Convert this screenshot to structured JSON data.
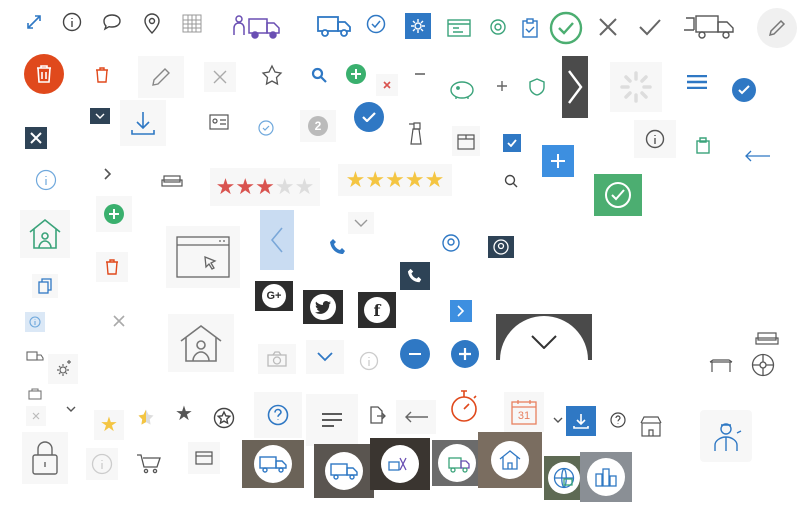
{
  "colors": {
    "accent_blue": "#2f78c4",
    "dark_navy": "#2e4356",
    "brand_orange": "#e0491c",
    "check_green": "#4cae71",
    "star_red": "#d9534f",
    "star_gold": "#f4c542",
    "light_blue_tile": "#c9dcf2",
    "bg_tile": "#f7f7f7"
  },
  "icons": [
    "expand-icon",
    "info-icon",
    "chat-icon",
    "location-pin-icon",
    "calendar-grid-icon",
    "delivery-truck-people-icon",
    "truck-icon",
    "check-circle-icon",
    "settings-badge-icon",
    "store-id-card-icon",
    "gear-shield-icon",
    "clipboard-icon",
    "green-check-circle-icon",
    "close-icon",
    "checkmark-icon",
    "truck-boxes-icon",
    "pencil-icon",
    "trash-round-icon",
    "trash-icon",
    "edit-pencil-icon",
    "close-light-icon",
    "star-add-icon",
    "search-icon",
    "plus-green-icon",
    "close-red-icon",
    "minus-icon",
    "piggy-bank-icon",
    "plus-icon",
    "shield-icon",
    "chevron-right-dark-icon",
    "spinner-icon",
    "hamburger-icon",
    "check-blue-circle-icon",
    "chevron-down-dark-icon",
    "download-icon",
    "id-card-icon",
    "check-outline-icon",
    "badge-number-icon",
    "check-circle-blue-icon",
    "spray-bottle-icon",
    "package-icon",
    "checkbox-checked-icon",
    "plus-blue-square-icon",
    "info-outline-icon",
    "clipboard-green-icon",
    "arrow-left-icon",
    "close-dark-icon",
    "info-circle-icon",
    "chevron-right-icon",
    "sofa-icon",
    "star-rating-red",
    "star-rating-gold",
    "search-small-icon",
    "check-green-square-icon",
    "home-user-icon",
    "plus-green-circle-icon",
    "browser-cursor-icon",
    "chevron-left-icon",
    "chevron-down-icon",
    "phone-icon",
    "user-circle-icon",
    "user-circle-dark-icon",
    "copy-icon",
    "trash-red-icon",
    "phone-dark-icon",
    "google-plus-icon",
    "twitter-icon",
    "facebook-icon",
    "chevron-right-blue-icon",
    "info-light-icon",
    "close-gray-icon",
    "house-user-icon",
    "camera-icon",
    "chevron-down-blue-icon",
    "minus-blue-circle-icon",
    "plus-blue-circle-icon",
    "chevron-down-round-icon",
    "sofa-outline-icon",
    "truck-small-icon",
    "gear-plus-icon",
    "info-gray-icon",
    "table-icon",
    "wheel-icon",
    "box-small-icon",
    "star-gold-icon",
    "star-half-icon",
    "star-dark-icon",
    "star-circle-icon",
    "question-circle-icon",
    "lines-icon",
    "document-arrow-icon",
    "arrow-left-long-icon",
    "stopwatch-icon",
    "calendar-31-icon",
    "download-blue-icon",
    "question-small-icon",
    "store-small-icon",
    "mechanic-icon",
    "lock-icon",
    "info-bottom-icon",
    "cart-icon",
    "credit-card-icon",
    "photo-truck-1",
    "photo-truck-2",
    "photo-truck-3",
    "photo-truck-4",
    "photo-house-5",
    "photo-globe-6",
    "photo-city-7"
  ],
  "labels": {
    "badge_number": "2",
    "calendar_day": "31",
    "google_plus": "G+",
    "facebook": "f"
  },
  "ratings": {
    "red_stars": 3,
    "gold_stars": 5,
    "total": 5
  }
}
